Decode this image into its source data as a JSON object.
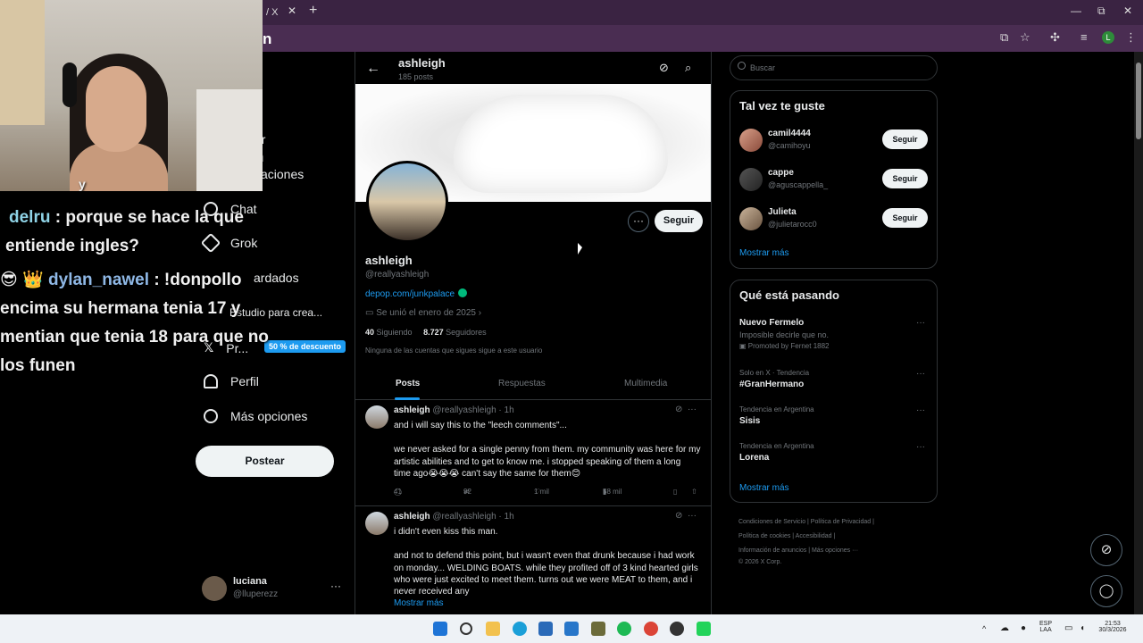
{
  "browser": {
    "tab_title": "/ X",
    "tab_close": "✕",
    "new_tab": "+",
    "address_fragment": "n",
    "profile_initial": "L",
    "minimize": "—",
    "restore": "⧉",
    "close": "✕"
  },
  "left_nav": {
    "items": [
      {
        "label": "ar"
      },
      {
        "label": "n"
      },
      {
        "label": "caciones"
      },
      {
        "label": "Chat"
      },
      {
        "label": "Grok"
      },
      {
        "label": "ardados"
      },
      {
        "label": "Estudio para crea..."
      },
      {
        "label": "Pr..."
      },
      {
        "label": "Perfil"
      },
      {
        "label": "Más opciones"
      }
    ],
    "promo_badge": "50 % de descuento",
    "post_button": "Postear",
    "account": {
      "name": "luciana",
      "handle": "@lluperezz",
      "more": "···"
    }
  },
  "stream_chat": [
    {
      "user": "",
      "text": "y"
    },
    {
      "user": "delru",
      "text": ": porque se hace la que"
    },
    {
      "user": "",
      "text": "entiende ingles?"
    },
    {
      "user": "dylan_nawel",
      "text": ": !donpollo"
    },
    {
      "user": "",
      "text": "encima su hermana tenia 17 y"
    },
    {
      "user": "",
      "text": "mentian que tenia 18 para que no"
    },
    {
      "user": "",
      "text": "los funen"
    }
  ],
  "profile_header": {
    "back": "←",
    "name": "ashleigh",
    "post_count": "185 posts"
  },
  "profile": {
    "more": "···",
    "follow_button": "Seguir",
    "display_name": "ashleigh",
    "handle": "@reallyashleigh",
    "link": "depop.com/junkpalace",
    "joined": "Se unió el enero de 2025",
    "following_count": "40",
    "following_label": "Siguiendo",
    "followers_count": "8.727",
    "followers_label": "Seguidores",
    "note": "Ninguna de las cuentas que sigues sigue a este usuario"
  },
  "tabs": [
    {
      "label": "Posts"
    },
    {
      "label": "Respuestas"
    },
    {
      "label": "Multimedia"
    }
  ],
  "tweets": [
    {
      "name": "ashleigh",
      "meta": "@reallyashleigh · 1h",
      "line1": "and i will say this to the \"leech comments\"...",
      "line2": "we never asked for a single penny from them. my community was here for my",
      "line3": "artistic abilities and to get to know me. i stopped speaking of them a long",
      "line4": "time ago😭😭😭 can't say the same for them😊",
      "replies": "41",
      "reposts": "92",
      "likes": "1 mil",
      "views": "58 mil"
    },
    {
      "name": "ashleigh",
      "meta": "@reallyashleigh · 1h",
      "line1": "i didn't even kiss this man.",
      "line2": "and not to defend this point, but i wasn't even that drunk because i had work",
      "line3": "on monday... WELDING BOATS. while they profited off of 3 kind hearted girls",
      "line4": "who were just excited to meet them. turns out we were MEAT to them, and i",
      "line5": "never received any",
      "show_more": "Mostrar más"
    }
  ],
  "search": {
    "placeholder": "Buscar"
  },
  "suggestions": {
    "title": "Tal vez te guste",
    "items": [
      {
        "name": "camil4444",
        "handle": "@camihoyu",
        "button": "Seguir"
      },
      {
        "name": "cappe",
        "handle": "@aguscappella_",
        "button": "Seguir"
      },
      {
        "name": "Julieta",
        "handle": "@julietarocc0",
        "button": "Seguir"
      }
    ],
    "show_more": "Mostrar más"
  },
  "trends": {
    "title": "Qué está pasando",
    "items": [
      {
        "context": "",
        "title": "Nuevo Fermelo",
        "subtitle": "Imposible decirle que no.",
        "promo": "Promoted by Fernet 1882"
      },
      {
        "context": "Solo en X · Tendencia",
        "title": "#GranHermano"
      },
      {
        "context": "Tendencia en Argentina",
        "title": "Sisis"
      },
      {
        "context": "Tendencia en Argentina",
        "title": "Lorena"
      }
    ],
    "show_more": "Mostrar más"
  },
  "footer": {
    "line1": "Condiciones de Servicio  |  Política de Privacidad  |",
    "line2": "Política de cookies  |  Accesibilidad  |",
    "line3": "Información de anuncios  |  Más opciones ···",
    "line4": "© 2026 X Corp."
  },
  "taskbar": {
    "lang_top": "ESP",
    "lang_bottom": "LAA",
    "time": "21:53",
    "date": "30/3/2026"
  }
}
